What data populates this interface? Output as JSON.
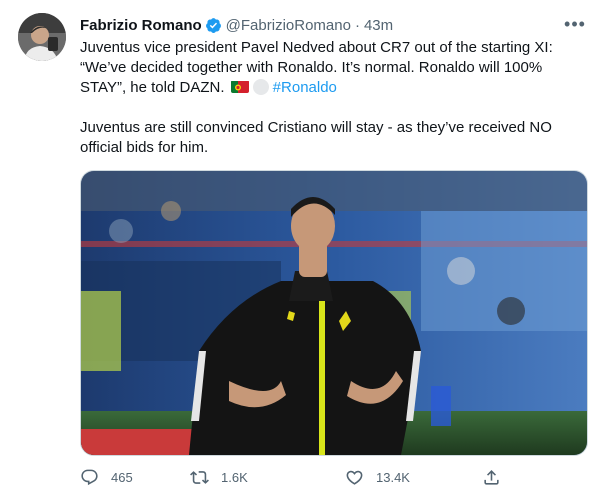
{
  "author": {
    "name": "Fabrizio Romano",
    "handle": "@FabrizioRomano",
    "separator": "·",
    "time": "43m"
  },
  "menu": {
    "label": "•••"
  },
  "tweet": {
    "line1": "Juventus vice president Pavel Nedved about CR7 out of the starting XI: “We’ve decided together with Ronaldo. It’s normal. Ronaldo will 100% STAY”, he told DAZN.",
    "hashtag": "#Ronaldo",
    "paragraph2": "Juventus are still convinced Cristiano will stay - as they’ve received NO official bids for him."
  },
  "icons": {
    "verified": "verified-badge-icon",
    "flag": "portugal-flag-icon",
    "reply": "reply-icon",
    "retweet": "retweet-icon",
    "like": "heart-icon",
    "share": "share-icon"
  },
  "colors": {
    "accent": "#1d9bf0",
    "muted": "#536471",
    "text": "#0f1419"
  },
  "actions": {
    "replies": "465",
    "retweets": "1.6K",
    "likes": "13.4K"
  }
}
